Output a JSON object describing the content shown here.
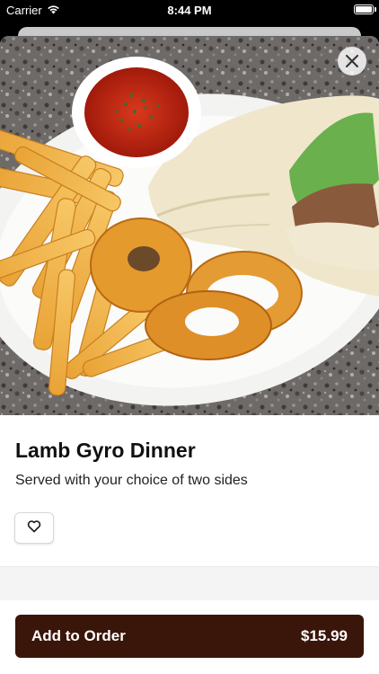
{
  "status_bar": {
    "carrier": "Carrier",
    "time": "8:44 PM",
    "icons": [
      "wifi-icon",
      "battery-icon"
    ]
  },
  "item": {
    "name": "Lamb Gyro Dinner",
    "description": "Served with your choice of two sides"
  },
  "actions": {
    "close_icon": "close-icon",
    "favorite_icon": "heart-icon"
  },
  "order_button": {
    "label": "Add to Order",
    "price": "$15.99"
  },
  "colors": {
    "accent": "#3a1509",
    "background": "#ffffff"
  }
}
